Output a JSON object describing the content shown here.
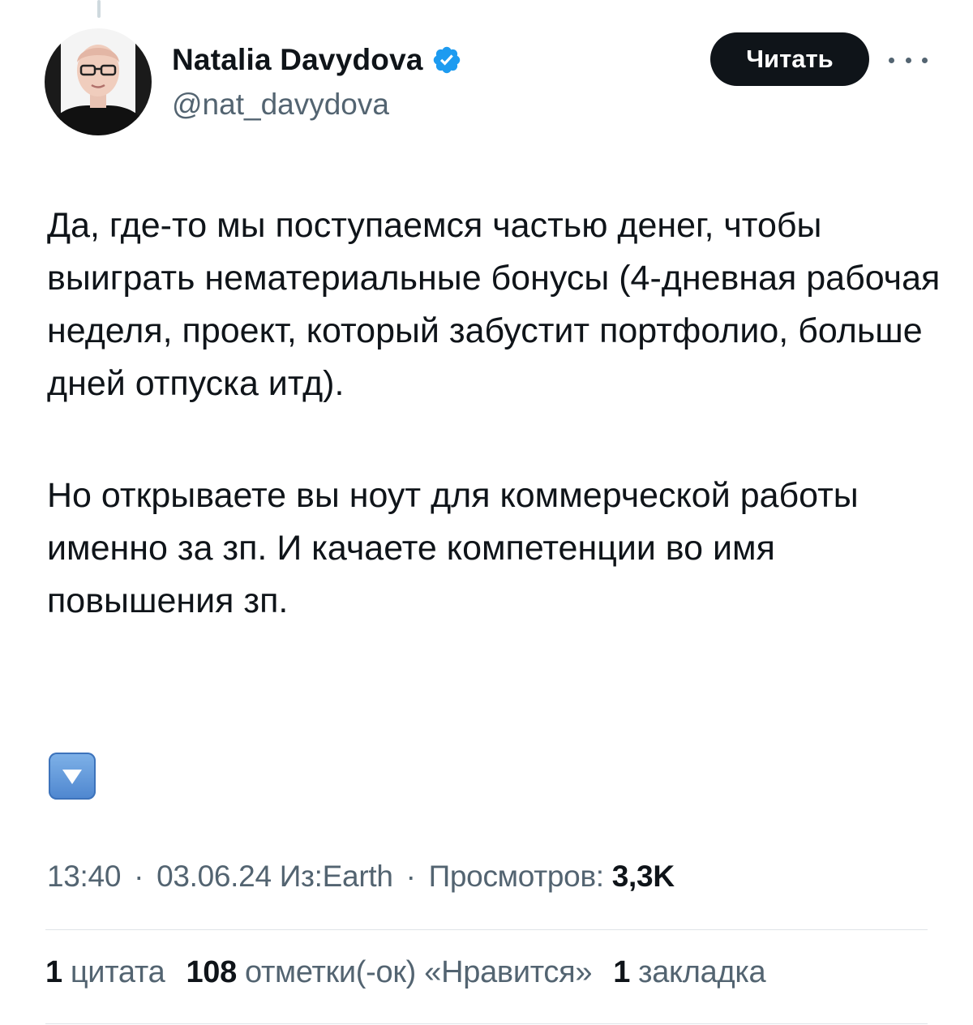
{
  "author": {
    "display_name": "Natalia Davydova",
    "handle": "@nat_davydova",
    "verified_icon": "verified-badge-icon",
    "verified_color": "#1d9bf0"
  },
  "follow_button": {
    "label": "Читать"
  },
  "tweet": {
    "paragraph_1": "Да, где-то мы поступаемся частью денег, чтобы выиграть нематериальные бонусы (4-дневная рабочая неделя, проект, который забустит портфолио, больше дней отпуска итд).",
    "paragraph_2": "Но открываете вы ноут для коммерческой работы именно за зп. И качаете компетенции во имя повышения зп.",
    "emoji": "down-arrow-button-emoji"
  },
  "meta": {
    "time": "13:40",
    "date": "03.06.24",
    "source": "Из:Earth",
    "views_label": "Просмотров:",
    "views_count": "3,3K",
    "separator": "·"
  },
  "stats": {
    "quotes_count": "1",
    "quotes_label": "цитата",
    "likes_count": "108",
    "likes_label": "отметки(-ок) «Нравится»",
    "bookmarks_count": "1",
    "bookmarks_label": "закладка"
  },
  "colors": {
    "text_primary": "#0f1419",
    "text_secondary": "#536471",
    "button_bg": "#0f1419",
    "divider": "#dfe4e8"
  }
}
